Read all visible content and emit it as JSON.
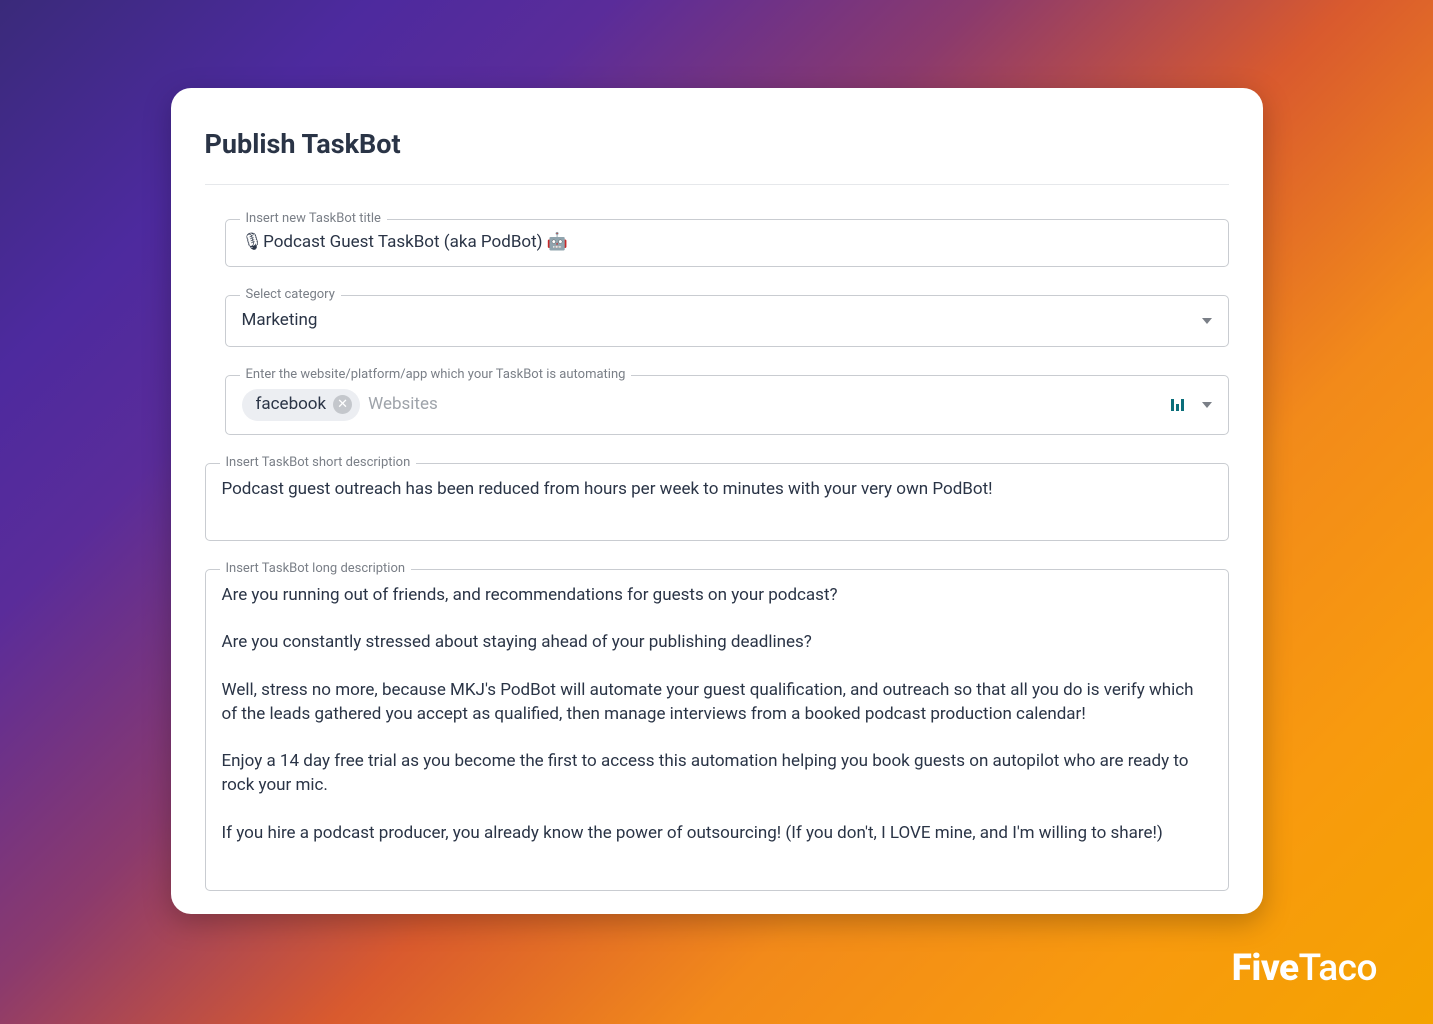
{
  "page_title": "Publish TaskBot",
  "labels": {
    "title_field": "Insert new TaskBot title",
    "category_field": "Select category",
    "platform_field": "Enter the website/platform/app which your TaskBot is automating",
    "short_desc_field": "Insert TaskBot short description",
    "long_desc_field": "Insert TaskBot long description"
  },
  "values": {
    "title": "🎙Podcast Guest TaskBot (aka PodBot) 🤖",
    "category": "Marketing",
    "platform_tag": "facebook",
    "platform_placeholder": "Websites",
    "short_description": "Podcast guest outreach has been reduced from hours per week to minutes with your very own PodBot!",
    "long_description": "Are you running out of friends, and recommendations for guests on your podcast?\n\nAre you constantly stressed about staying ahead of your publishing deadlines?\n\nWell, stress no more, because MKJ's PodBot will automate your guest qualification, and outreach so that all you do is verify which of the leads gathered you accept as qualified, then manage interviews from a booked podcast production calendar!\n\nEnjoy a 14 day free trial as you become the first to access this automation helping you book guests on autopilot who are ready to rock your mic.\n\nIf you hire a podcast producer, you already know the power of outsourcing! (If you don't, I LOVE mine, and I'm willing to share!)"
  },
  "brand": {
    "bold": "Five",
    "light": "Taco"
  }
}
